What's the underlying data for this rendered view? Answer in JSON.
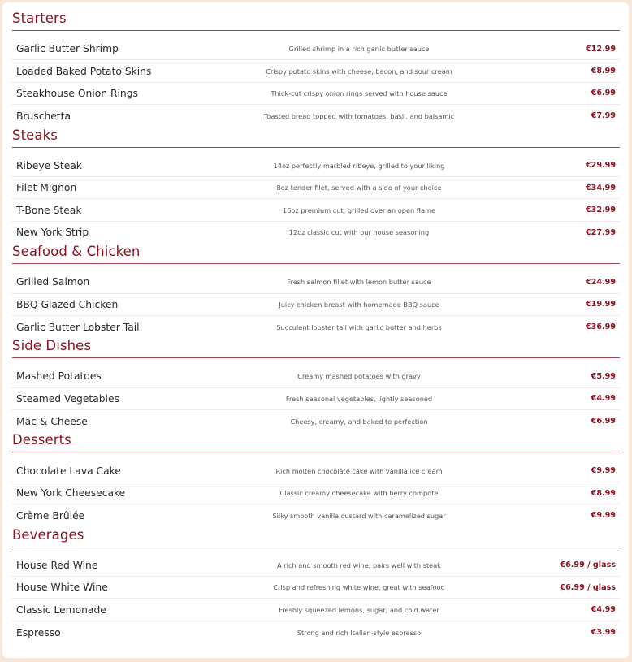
{
  "menu": {
    "sections": [
      {
        "title": "Starters",
        "items": [
          {
            "name": "Garlic Butter Shrimp",
            "description": "Grilled shrimp in a rich garlic butter sauce",
            "price": "€12.99"
          },
          {
            "name": "Loaded Baked Potato Skins",
            "description": "Crispy potato skins with cheese, bacon, and sour cream",
            "price": "€8.99"
          },
          {
            "name": "Steakhouse Onion Rings",
            "description": "Thick-cut crispy onion rings served with house sauce",
            "price": "€6.99"
          },
          {
            "name": "Bruschetta",
            "description": "Toasted bread topped with tomatoes, basil, and balsamic",
            "price": "€7.99"
          }
        ]
      },
      {
        "title": "Steaks",
        "items": [
          {
            "name": "Ribeye Steak",
            "description": "14oz perfectly marbled ribeye, grilled to your liking",
            "price": "€29.99"
          },
          {
            "name": "Filet Mignon",
            "description": "8oz tender filet, served with a side of your choice",
            "price": "€34.99"
          },
          {
            "name": "T-Bone Steak",
            "description": "16oz premium cut, grilled over an open flame",
            "price": "€32.99"
          },
          {
            "name": "New York Strip",
            "description": "12oz classic cut with our house seasoning",
            "price": "€27.99"
          }
        ]
      },
      {
        "title": "Seafood & Chicken",
        "items": [
          {
            "name": "Grilled Salmon",
            "description": "Fresh salmon fillet with lemon butter sauce",
            "price": "€24.99"
          },
          {
            "name": "BBQ Glazed Chicken",
            "description": "Juicy chicken breast with homemade BBQ sauce",
            "price": "€19.99"
          },
          {
            "name": "Garlic Butter Lobster Tail",
            "description": "Succulent lobster tail with garlic butter and herbs",
            "price": "€36.99"
          }
        ]
      },
      {
        "title": "Side Dishes",
        "items": [
          {
            "name": "Mashed Potatoes",
            "description": "Creamy mashed potatoes with gravy",
            "price": "€5.99"
          },
          {
            "name": "Steamed Vegetables",
            "description": "Fresh seasonal vegetables, lightly seasoned",
            "price": "€4.99"
          },
          {
            "name": "Mac & Cheese",
            "description": "Cheesy, creamy, and baked to perfection",
            "price": "€6.99"
          }
        ]
      },
      {
        "title": "Desserts",
        "items": [
          {
            "name": "Chocolate Lava Cake",
            "description": "Rich molten chocolate cake with vanilla ice cream",
            "price": "€9.99"
          },
          {
            "name": "New York Cheesecake",
            "description": "Classic creamy cheesecake with berry compote",
            "price": "€8.99"
          },
          {
            "name": "Crème Brûlée",
            "description": "Silky smooth vanilla custard with caramelized sugar",
            "price": "€9.99"
          }
        ]
      },
      {
        "title": "Beverages",
        "items": [
          {
            "name": "House Red Wine",
            "description": "A rich and smooth red wine, pairs well with steak",
            "price": "€6.99 / glass"
          },
          {
            "name": "House White Wine",
            "description": "Crisp and refreshing white wine, great with seafood",
            "price": "€6.99 / glass"
          },
          {
            "name": "Classic Lemonade",
            "description": "Freshly squeezed lemons, sugar, and cold water",
            "price": "€4.99"
          },
          {
            "name": "Espresso",
            "description": "Strong and rich Italian-style espresso",
            "price": "€3.99"
          }
        ]
      }
    ]
  },
  "colors": {
    "accent": "#8b1220",
    "background": "#f7e7da",
    "card": "#ffffff"
  }
}
